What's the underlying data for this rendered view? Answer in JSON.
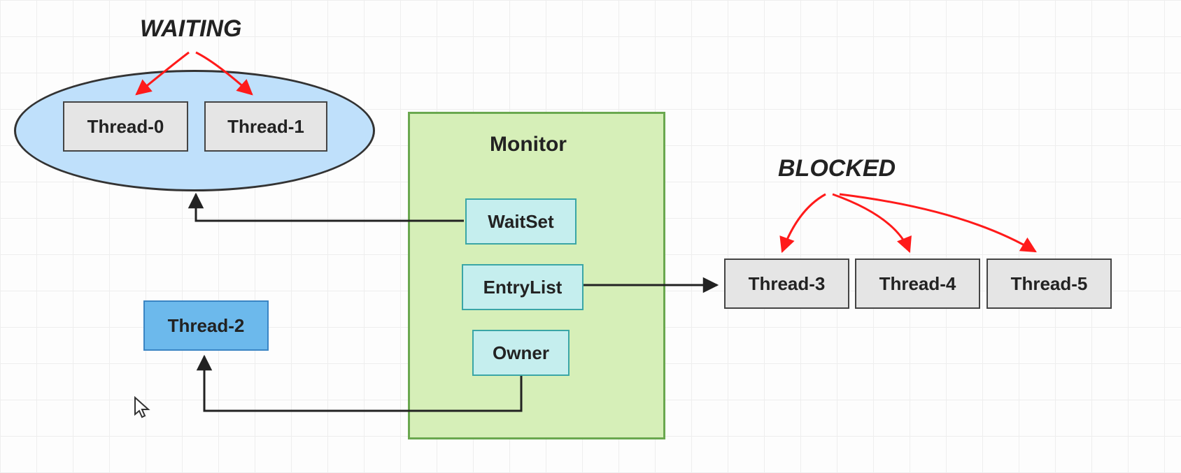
{
  "titles": {
    "waiting": "WAITING",
    "blocked": "BLOCKED",
    "monitor": "Monitor"
  },
  "monitor": {
    "waitset": "WaitSet",
    "entrylist": "EntryList",
    "owner": "Owner"
  },
  "threads": {
    "t0": "Thread-0",
    "t1": "Thread-1",
    "t2": "Thread-2",
    "t3": "Thread-3",
    "t4": "Thread-4",
    "t5": "Thread-5"
  },
  "colors": {
    "red": "#ff1a1a",
    "black": "#222222",
    "monitorFill": "#d6efb8",
    "monitorBorder": "#6aa84f",
    "ellipseFill": "#bfe0fb",
    "cyanFill": "#c5eeee",
    "blueFill": "#6cb9ec",
    "grayFill": "#e5e5e5"
  }
}
